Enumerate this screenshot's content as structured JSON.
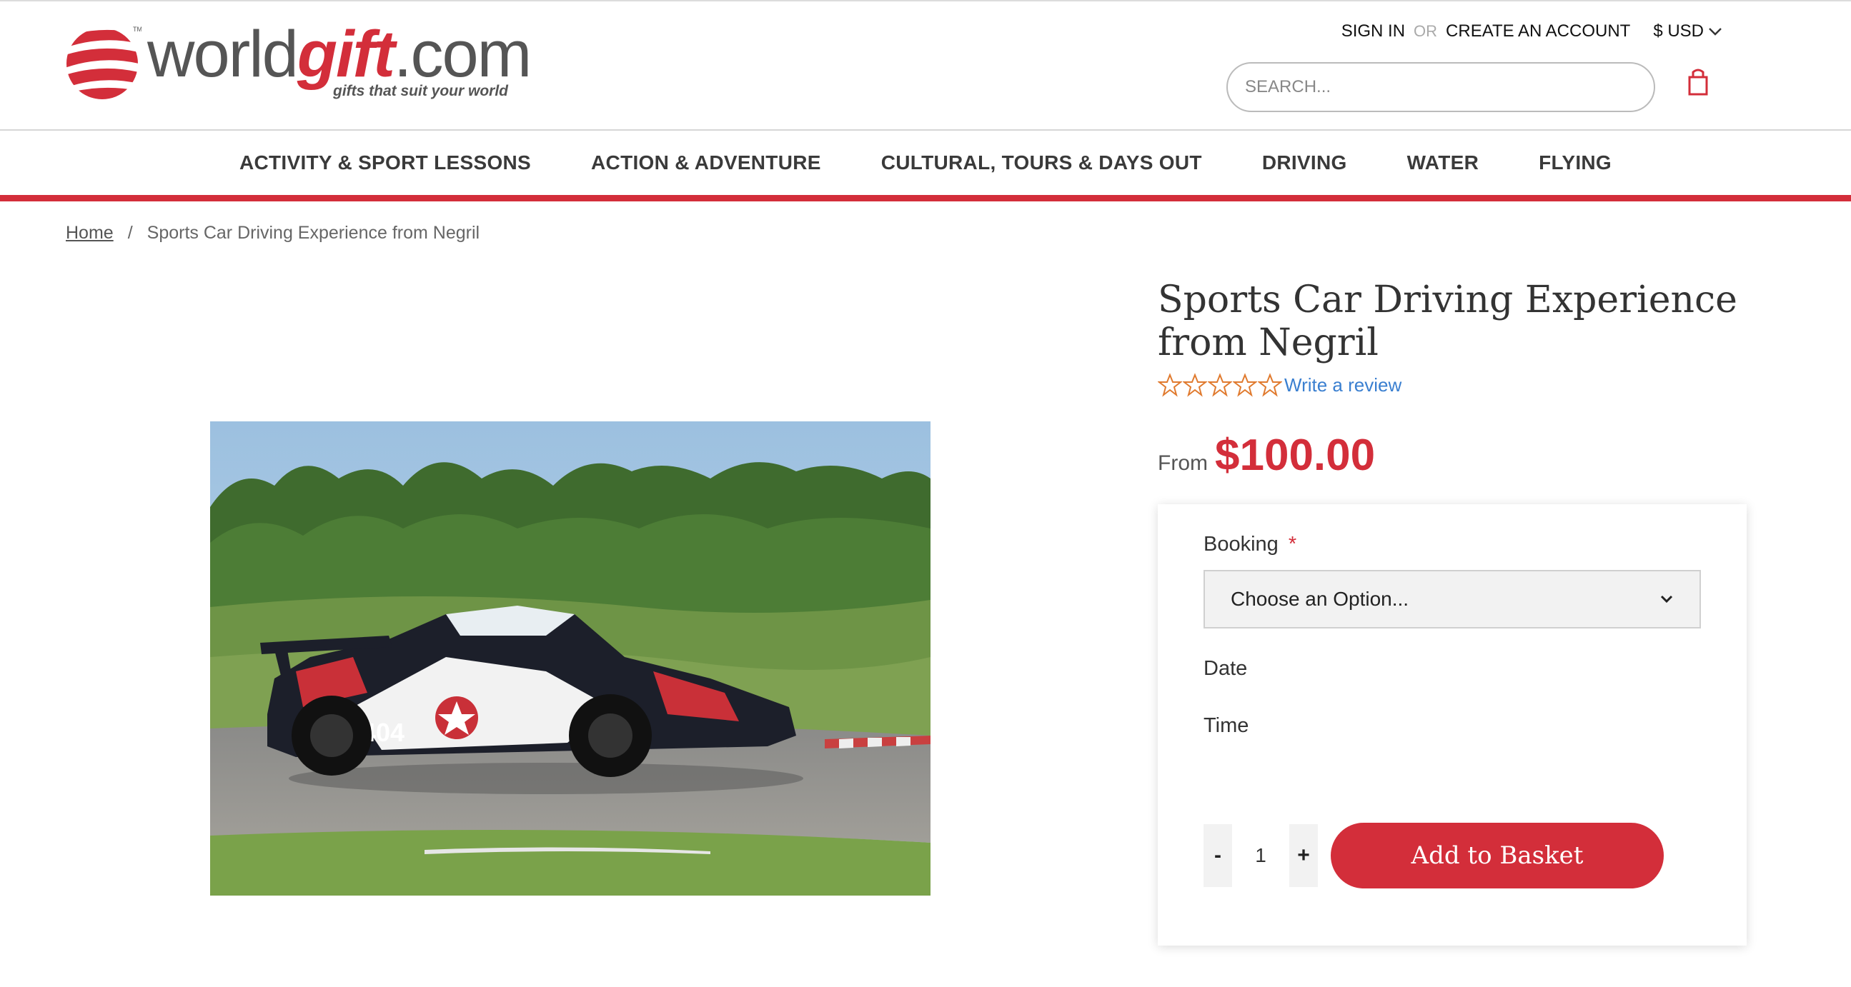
{
  "header": {
    "logo": {
      "brand_prefix": "world",
      "brand_highlight": "gift",
      "brand_suffix": ".com",
      "tagline": "gifts that suit your world"
    },
    "account": {
      "sign_in": "SIGN IN",
      "or": "OR",
      "create_account": "CREATE AN ACCOUNT",
      "currency": "$ USD"
    },
    "search": {
      "placeholder": "SEARCH..."
    },
    "cart_icon": "shopping-bag-icon"
  },
  "nav": {
    "items": [
      "ACTIVITY & SPORT LESSONS",
      "ACTION & ADVENTURE",
      "CULTURAL, TOURS & DAYS OUT",
      "DRIVING",
      "WATER",
      "FLYING"
    ]
  },
  "breadcrumb": {
    "home": "Home",
    "separator": "/",
    "current": "Sports Car Driving Experience from Negril"
  },
  "product": {
    "title": "Sports Car Driving Experience from Negril",
    "rating": {
      "stars": 0,
      "max": 5,
      "review_link": "Write a review"
    },
    "price_prefix": "From",
    "price": "$100.00",
    "options": {
      "booking_label": "Booking",
      "required_marker": "*",
      "booking_selected": "Choose an Option...",
      "date_label": "Date",
      "time_label": "Time"
    },
    "quantity": {
      "minus": "-",
      "value": "1",
      "plus": "+"
    },
    "add_to_basket": "Add to Basket"
  },
  "colors": {
    "brand_red": "#d32e3a",
    "link_blue": "#3a7fd0",
    "star_orange": "#e07a2e"
  }
}
